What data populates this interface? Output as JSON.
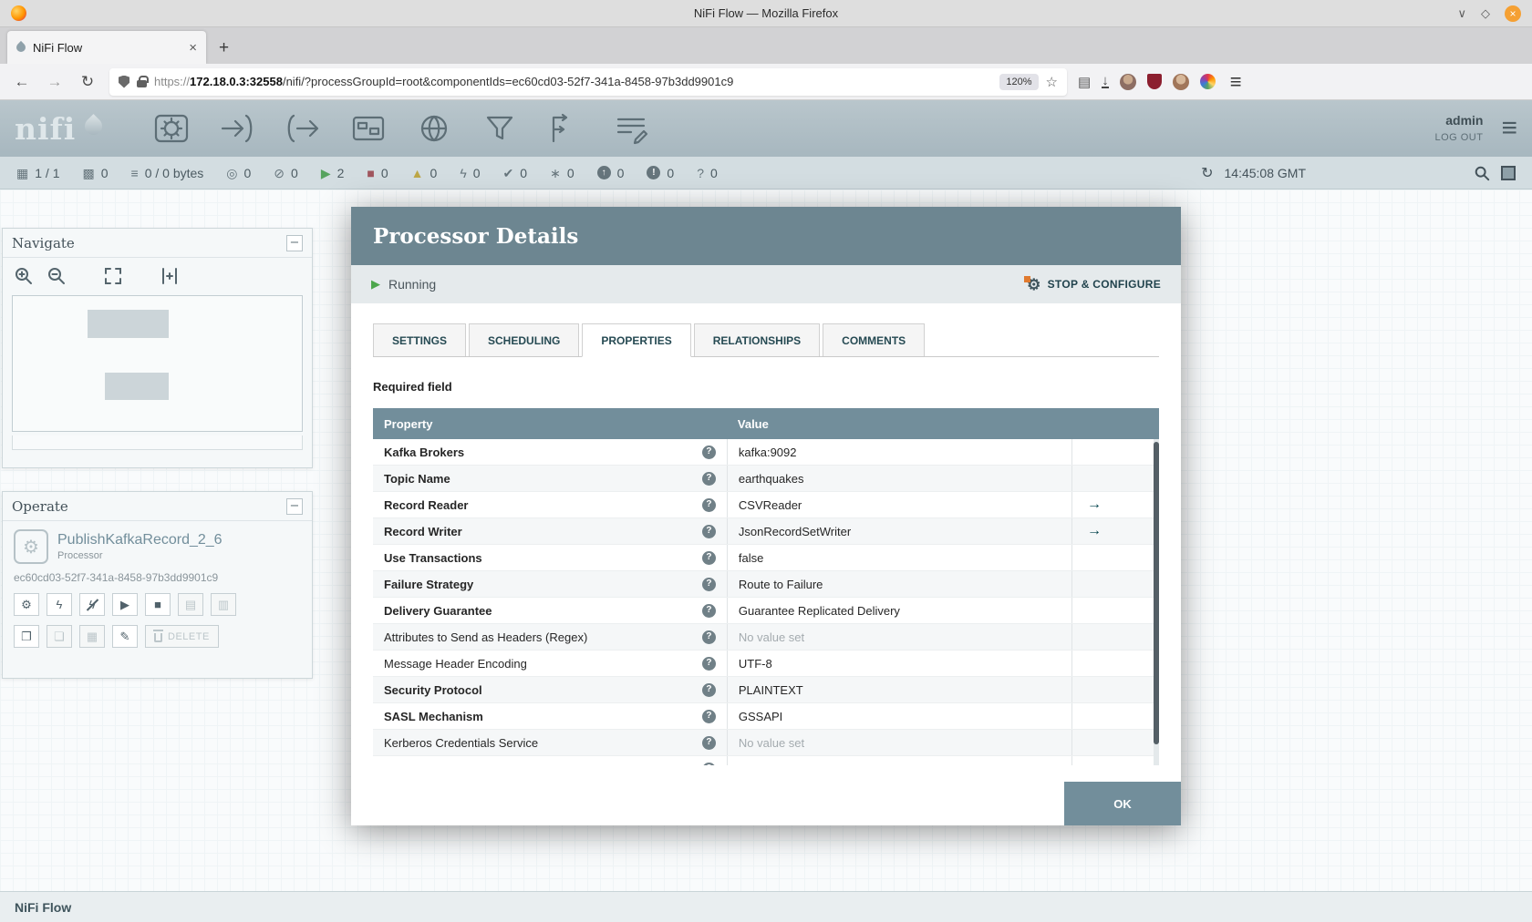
{
  "titlebar": {
    "title": "NiFi Flow — Mozilla Firefox"
  },
  "tabbar": {
    "tab_title": "NiFi Flow",
    "new_tab_label": "+"
  },
  "urlbar": {
    "scheme": "https://",
    "host": "172.18.0.3:32558",
    "path": "/nifi/?processGroupId=root&componentIds=ec60cd03-52f7-341a-8458-97b3dd9901c9",
    "zoom": "120%"
  },
  "nifi_header": {
    "logo": "nifi",
    "user": "admin",
    "logout": "LOG OUT",
    "toolbar_icons": [
      "processor-icon",
      "input-port-icon",
      "output-port-icon",
      "process-group-icon",
      "remote-process-group-icon",
      "funnel-icon",
      "template-icon",
      "label-icon"
    ]
  },
  "status_bar": {
    "items": [
      {
        "name": "clustered-nodes-icon",
        "glyph": "▦",
        "value": "1 / 1",
        "color": "#66757c"
      },
      {
        "name": "active-threads-icon",
        "glyph": "▩",
        "value": "0",
        "color": "#66757c"
      },
      {
        "name": "queued-data-icon",
        "glyph": "≡",
        "value": "0 / 0 bytes",
        "color": "#66757c"
      },
      {
        "name": "transmitting-icon",
        "glyph": "◎",
        "value": "0",
        "color": "#66757c"
      },
      {
        "name": "not-transmitting-icon",
        "glyph": "⊘",
        "value": "0",
        "color": "#66757c"
      },
      {
        "name": "running-icon",
        "glyph": "▶",
        "value": "2",
        "color": "#57a35f"
      },
      {
        "name": "stopped-icon",
        "glyph": "■",
        "value": "0",
        "color": "#a0565e"
      },
      {
        "name": "invalid-icon",
        "glyph": "▲",
        "value": "0",
        "color": "#bda747"
      },
      {
        "name": "disabled-icon",
        "glyph": "ϟ",
        "value": "0",
        "color": "#66757c"
      },
      {
        "name": "up-to-date-icon",
        "glyph": "✔",
        "value": "0",
        "color": "#66757c"
      },
      {
        "name": "locally-modified-icon",
        "glyph": "∗",
        "value": "0",
        "color": "#66757c"
      },
      {
        "name": "stale-icon",
        "glyph": "circle:↑",
        "value": "0",
        "color": "#66757c"
      },
      {
        "name": "locally-modified-stale-icon",
        "glyph": "circle:!",
        "value": "0",
        "color": "#66757c"
      },
      {
        "name": "sync-failure-icon",
        "glyph": "?",
        "value": "0",
        "color": "#66757c"
      }
    ],
    "time": "14:45:08 GMT"
  },
  "navigate": {
    "title": "Navigate"
  },
  "operate": {
    "title": "Operate",
    "name": "PublishKafkaRecord_2_6",
    "type": "Processor",
    "id": "ec60cd03-52f7-341a-8458-97b3dd9901c9",
    "delete_label": "DELETE",
    "buttons_row1": [
      {
        "name": "configure-button",
        "glyph": "⚙",
        "disabled": false
      },
      {
        "name": "enable-button",
        "glyph": "ϟ",
        "disabled": false
      },
      {
        "name": "disable-button",
        "glyph": "ϟ",
        "slash": true,
        "disabled": false
      },
      {
        "name": "start-button",
        "glyph": "▶",
        "disabled": false
      },
      {
        "name": "stop-button",
        "glyph": "■",
        "disabled": false
      },
      {
        "name": "create-template-button",
        "glyph": "▤",
        "disabled": true
      },
      {
        "name": "upload-template-button",
        "glyph": "▥",
        "disabled": true
      }
    ],
    "buttons_row2": [
      {
        "name": "copy-button",
        "glyph": "❐",
        "disabled": false
      },
      {
        "name": "paste-button",
        "glyph": "❏",
        "disabled": true
      },
      {
        "name": "group-button",
        "glyph": "▦",
        "disabled": true
      },
      {
        "name": "color-button",
        "glyph": "✎",
        "disabled": false
      }
    ]
  },
  "dialog": {
    "title": "Processor Details",
    "status_label": "Running",
    "stop_configure_label": "STOP & CONFIGURE",
    "tabs": [
      {
        "label": "SETTINGS",
        "active": false
      },
      {
        "label": "SCHEDULING",
        "active": false
      },
      {
        "label": "PROPERTIES",
        "active": true
      },
      {
        "label": "RELATIONSHIPS",
        "active": false
      },
      {
        "label": "COMMENTS",
        "active": false
      }
    ],
    "required_label": "Required field",
    "table": {
      "property_header": "Property",
      "value_header": "Value",
      "rows": [
        {
          "property": "Kafka Brokers",
          "value": "kafka:9092",
          "required": true,
          "unset": false,
          "goto": false
        },
        {
          "property": "Topic Name",
          "value": "earthquakes",
          "required": true,
          "unset": false,
          "goto": false
        },
        {
          "property": "Record Reader",
          "value": "CSVReader",
          "required": true,
          "unset": false,
          "goto": true
        },
        {
          "property": "Record Writer",
          "value": "JsonRecordSetWriter",
          "required": true,
          "unset": false,
          "goto": true
        },
        {
          "property": "Use Transactions",
          "value": "false",
          "required": true,
          "unset": false,
          "goto": false
        },
        {
          "property": "Failure Strategy",
          "value": "Route to Failure",
          "required": true,
          "unset": false,
          "goto": false
        },
        {
          "property": "Delivery Guarantee",
          "value": "Guarantee Replicated Delivery",
          "required": true,
          "unset": false,
          "goto": false
        },
        {
          "property": "Attributes to Send as Headers (Regex)",
          "value": "No value set",
          "required": false,
          "unset": true,
          "goto": false
        },
        {
          "property": "Message Header Encoding",
          "value": "UTF-8",
          "required": false,
          "unset": false,
          "goto": false
        },
        {
          "property": "Security Protocol",
          "value": "PLAINTEXT",
          "required": true,
          "unset": false,
          "goto": false
        },
        {
          "property": "SASL Mechanism",
          "value": "GSSAPI",
          "required": true,
          "unset": false,
          "goto": false
        },
        {
          "property": "Kerberos Credentials Service",
          "value": "No value set",
          "required": false,
          "unset": true,
          "goto": false
        }
      ]
    },
    "ok_label": "OK"
  },
  "breadcrumb": {
    "label": "NiFi Flow"
  },
  "colors": {
    "accent_slate": "#728e9b",
    "header_teal": "#004849",
    "running_green": "#57a35f"
  }
}
